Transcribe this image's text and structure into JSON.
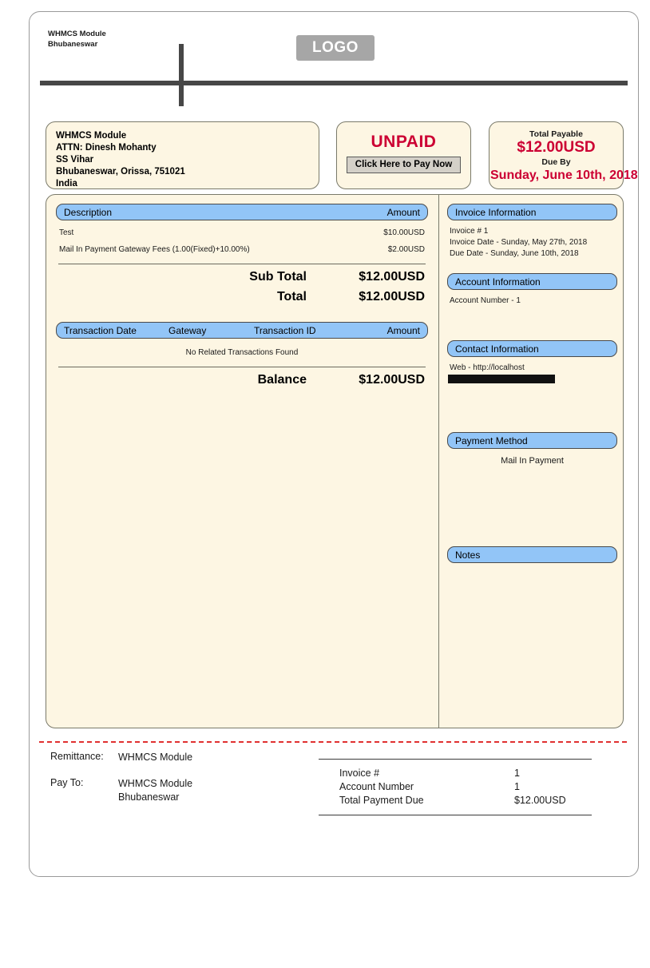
{
  "letterhead": {
    "company_lines": "WHMCS Module\nBhubaneswar",
    "logo_text": "LOGO"
  },
  "client_address": {
    "lines": [
      "WHMCS Module",
      "ATTN: Dinesh Mohanty",
      "SS Vihar",
      "Bhubaneswar, Orissa, 751021",
      "India"
    ]
  },
  "status": {
    "label": "UNPAID",
    "pay_button_label": "Click Here to Pay Now",
    "status_color": "#cc0033"
  },
  "total_payable": {
    "label": "Total Payable",
    "amount": "$12.00USD",
    "due_by_label": "Due By",
    "due_date": "Sunday, June 10th, 2018"
  },
  "items_table": {
    "header": {
      "description": "Description",
      "amount": "Amount"
    },
    "rows": [
      {
        "description": "Test",
        "amount": "$10.00USD"
      },
      {
        "description": "Mail In Payment Gateway Fees (1.00(Fixed)+10.00%)",
        "amount": "$2.00USD"
      }
    ],
    "totals": [
      {
        "label": "Sub Total",
        "value": "$12.00USD"
      },
      {
        "label": "Total",
        "value": "$12.00USD"
      }
    ]
  },
  "transactions_table": {
    "header": {
      "date": "Transaction Date",
      "gateway": "Gateway",
      "transaction_id": "Transaction ID",
      "amount": "Amount"
    },
    "empty_message": "No Related Transactions Found",
    "balance_label": "Balance",
    "balance_value": "$12.00USD"
  },
  "sidebar": {
    "invoice_information": {
      "title": "Invoice Information",
      "body": "Invoice # 1\nInvoice Date - Sunday, May 27th, 2018\nDue Date - Sunday, June 10th, 2018"
    },
    "account_information": {
      "title": "Account Information",
      "body": "Account Number - 1"
    },
    "contact_information": {
      "title": "Contact Information",
      "body": "Web - http://localhost"
    },
    "payment_method": {
      "title": "Payment Method",
      "value": "Mail In Payment"
    },
    "notes": {
      "title": "Notes",
      "body": ""
    }
  },
  "remittance": {
    "remittance_label": "Remittance:",
    "remittance_value": "WHMCS Module",
    "pay_to_label": "Pay To:",
    "pay_to_value": "WHMCS Module\nBhubaneswar"
  },
  "payment_summary": {
    "rows": [
      {
        "label": "Invoice #",
        "value": "1"
      },
      {
        "label": "Account Number",
        "value": "1"
      },
      {
        "label": "Total Payment Due",
        "value": "$12.00USD"
      }
    ]
  },
  "colors": {
    "paper": "#fdf6e3",
    "section_header": "#92c5f7",
    "accent_red": "#cc0033",
    "rule": "#474747",
    "remittance_dash": "#e03030"
  }
}
